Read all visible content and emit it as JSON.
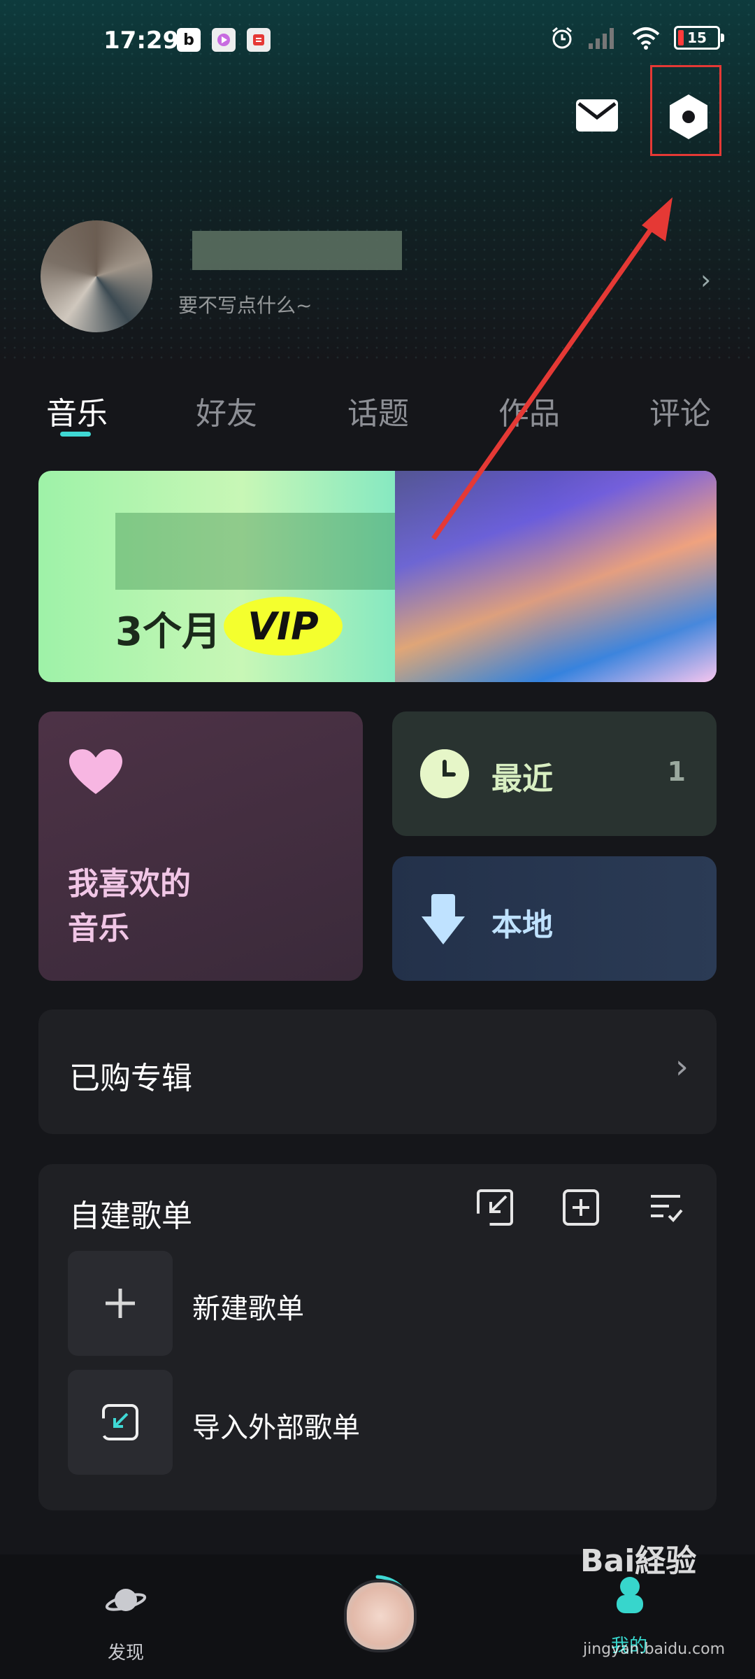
{
  "status_bar": {
    "time": "17:29",
    "battery": "15"
  },
  "profile": {
    "signature": "要不写点什么~"
  },
  "tabs": [
    {
      "label": "音乐"
    },
    {
      "label": "好友"
    },
    {
      "label": "话题"
    },
    {
      "label": "作品"
    },
    {
      "label": "评论"
    }
  ],
  "banner": {
    "months_text": "3个月",
    "vip_text": "VIP"
  },
  "quick_cards": {
    "favorite_line1": "我喜欢的",
    "favorite_line2": "音乐",
    "recent_label": "最近",
    "recent_count": "1",
    "local_label": "本地"
  },
  "purchased": {
    "label": "已购专辑"
  },
  "playlists": {
    "title": "自建歌单",
    "rows": [
      {
        "label": "新建歌单"
      },
      {
        "label": "导入外部歌单"
      }
    ]
  },
  "bottom_nav": {
    "discover_label": "发现",
    "mine_label": "我的"
  },
  "watermark": {
    "main": "Bai経验",
    "sub": "jingyan.baidu.com"
  },
  "colors": {
    "accent": "#3fd8d4",
    "annotation": "#e53935"
  }
}
